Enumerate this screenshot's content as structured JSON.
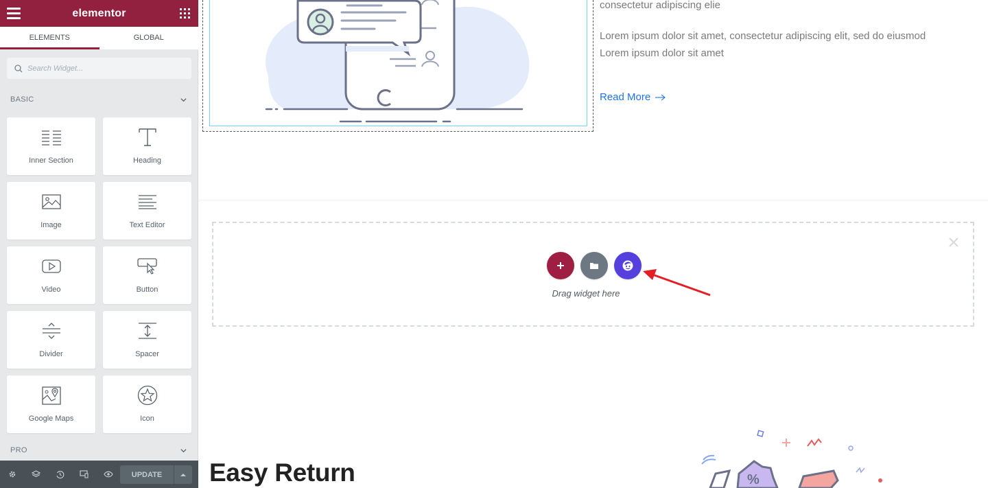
{
  "panel": {
    "logo": "elementor",
    "tabs": [
      {
        "label": "ELEMENTS",
        "active": true
      },
      {
        "label": "GLOBAL",
        "active": false
      }
    ],
    "search": {
      "placeholder": "Search Widget..."
    },
    "categories": {
      "basic": "BASIC",
      "pro": "PRO"
    },
    "widgets": [
      {
        "label": "Inner Section",
        "icon": "inner-section-icon"
      },
      {
        "label": "Heading",
        "icon": "heading-icon"
      },
      {
        "label": "Image",
        "icon": "image-icon"
      },
      {
        "label": "Text Editor",
        "icon": "text-editor-icon"
      },
      {
        "label": "Video",
        "icon": "video-icon"
      },
      {
        "label": "Button",
        "icon": "button-icon"
      },
      {
        "label": "Divider",
        "icon": "divider-icon"
      },
      {
        "label": "Spacer",
        "icon": "spacer-icon"
      },
      {
        "label": "Google Maps",
        "icon": "google-maps-icon"
      },
      {
        "label": "Icon",
        "icon": "star-icon"
      }
    ],
    "footer": {
      "icons": [
        "settings-icon",
        "layers-icon",
        "history-icon",
        "responsive-icon",
        "preview-icon"
      ],
      "update_label": "UPDATE"
    }
  },
  "canvas": {
    "text_line_1": "consectetur adipiscing elie",
    "text_para_line_1": "Lorem ipsum dolor sit amet, consectetur adipiscing elit, sed do eiusmod",
    "text_para_line_2": "Lorem ipsum dolor sit amet",
    "read_more": "Read More",
    "dropzone_text": "Drag widget here",
    "heading": "Easy Return"
  },
  "colors": {
    "brand": "#92203f",
    "add_button": "#9e1f41",
    "template_button": "#6d7882",
    "extension_button": "#5640dd",
    "link": "#1e73e8",
    "annotation_arrow": "#e31e24"
  }
}
